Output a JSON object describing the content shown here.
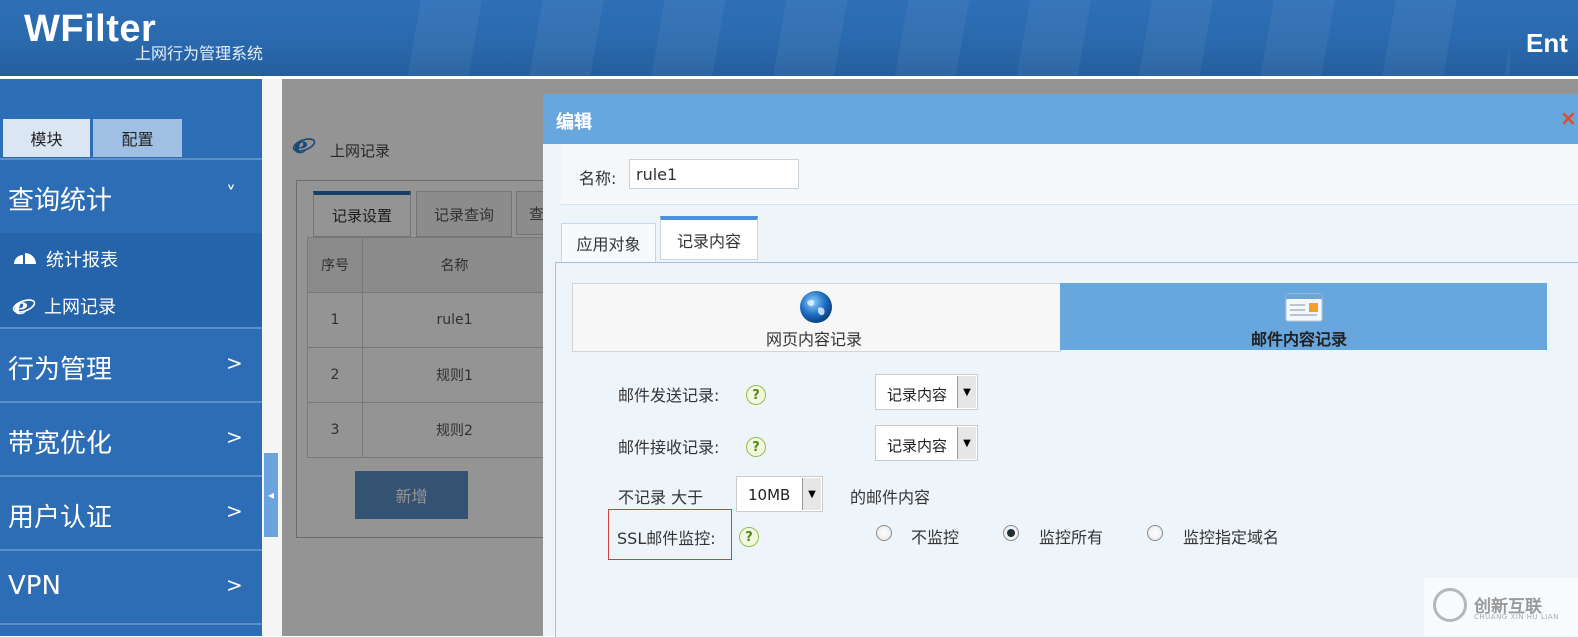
{
  "header": {
    "brand": "WFilter",
    "subtitle": "上网行为管理系统",
    "right_text": "Ent"
  },
  "sidebar": {
    "top_buttons": [
      "模块",
      "配置"
    ],
    "sections": [
      {
        "label": "查询统计",
        "arrow": "˅",
        "expanded": true
      },
      {
        "label": "行为管理",
        "arrow": ">"
      },
      {
        "label": "带宽优化",
        "arrow": ">"
      },
      {
        "label": "用户认证",
        "arrow": ">"
      },
      {
        "label": "VPN",
        "arrow": ">"
      }
    ],
    "sub_items": [
      {
        "label": "统计报表",
        "icon": "chart-icon"
      },
      {
        "label": "上网记录",
        "icon": "ie-icon"
      }
    ],
    "collapse_glyph": "◂"
  },
  "background_page": {
    "title": "上网记录",
    "tabs": [
      "记录设置",
      "记录查询",
      "查"
    ],
    "table": {
      "headers": [
        "序号",
        "名称"
      ],
      "rows": [
        [
          "1",
          "rule1"
        ],
        [
          "2",
          "规则1"
        ],
        [
          "3",
          "规则2"
        ]
      ]
    },
    "add_button": "新增"
  },
  "dialog": {
    "title": "编辑",
    "close_glyph": "×",
    "name_label": "名称:",
    "name_value": "rule1",
    "tabs": [
      "应用对象",
      "记录内容"
    ],
    "active_tab": "记录内容",
    "segments": [
      {
        "label": "网页内容记录",
        "icon": "globe-icon",
        "active": false
      },
      {
        "label": "邮件内容记录",
        "icon": "mail-icon",
        "active": true
      }
    ],
    "fields": {
      "send_label": "邮件发送记录:",
      "send_value": "记录内容",
      "receive_label": "邮件接收记录:",
      "receive_value": "记录内容",
      "size_prefix": "不记录 大于",
      "size_value": "10MB",
      "size_suffix": "的邮件内容",
      "ssl_label": "SSL邮件监控:",
      "ssl_options": [
        "不监控",
        "监控所有",
        "监控指定域名"
      ],
      "ssl_selected": "监控所有"
    },
    "help_glyph": "?",
    "dropdown_glyph": "▼"
  },
  "watermark": {
    "text": "创新互联",
    "sub": "CHUANG XIN HU LIAN"
  },
  "colors": {
    "header_blue": "#2a69ad",
    "sidebar_blue": "#2c6db5",
    "dialog_title": "#68a6de",
    "active_segment": "#68a6de",
    "highlight_box": "#d04040"
  }
}
